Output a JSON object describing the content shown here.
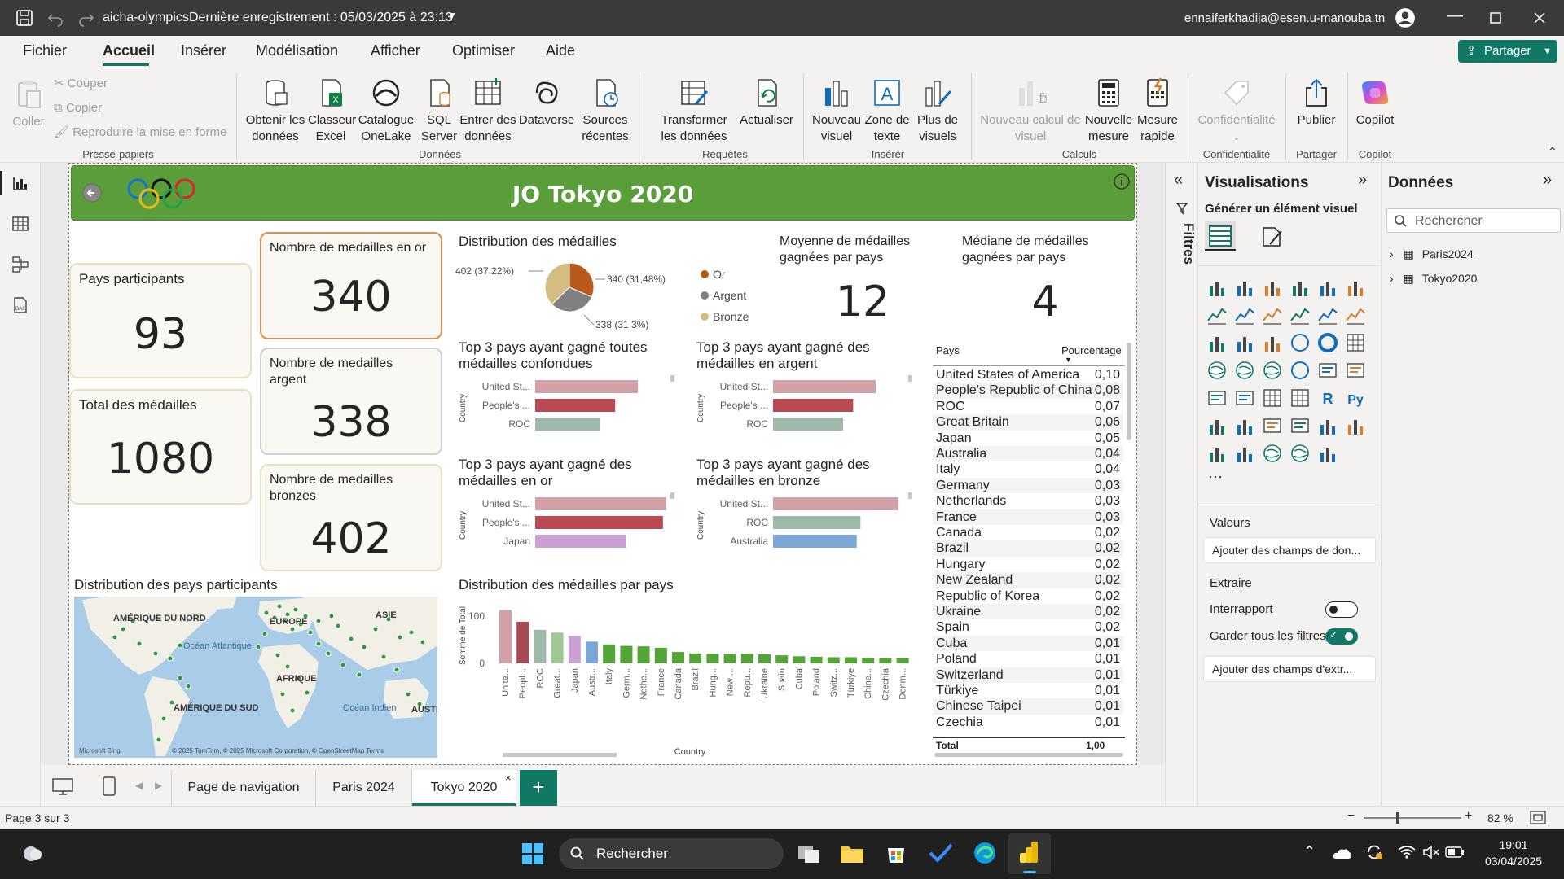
{
  "titlebar": {
    "file": "aicha-olympics",
    "saved": "Dernière enregistrement : 05/03/2025 à 23:13",
    "user": "ennaiferkhadija@esen.u-manouba.tn"
  },
  "menu": {
    "items": [
      "Fichier",
      "Accueil",
      "Insérer",
      "Modélisation",
      "Afficher",
      "Optimiser",
      "Aide"
    ],
    "share": "Partager"
  },
  "ribbon": {
    "coller": "Coller",
    "couper": "Couper",
    "copier": "Copier",
    "reproduire": "Reproduire la mise en forme",
    "presse": "Presse-papiers",
    "obtenir": "Obtenir les données",
    "classeur": "Classeur Excel",
    "onelake": "Catalogue OneLake",
    "sql": "SQL Server",
    "entrer": "Entrer des données",
    "dataverse": "Dataverse",
    "sources": "Sources récentes",
    "donnees": "Données",
    "transformer": "Transformer les données",
    "actualiser": "Actualiser",
    "requetes": "Requêtes",
    "nouveau_visuel": "Nouveau visuel",
    "zone_texte": "Zone de texte",
    "plus_visuels": "Plus de visuels",
    "inserer": "Insérer",
    "nouveau_calcul": "Nouveau calcul de visuel",
    "nouvelle_mesure": "Nouvelle mesure",
    "mesure_rapide": "Mesure rapide",
    "calculs": "Calculs",
    "confidentialite": "Confidentialité",
    "publier": "Publier",
    "partager": "Partager",
    "copilot": "Copilot"
  },
  "report": {
    "title": "JO Tokyo 2020",
    "cards": {
      "pays_label": "Pays participants",
      "pays_value": "93",
      "total_label": "Total des médailles",
      "total_value": "1080",
      "or_label": "Nombre de medailles en or",
      "or_value": "340",
      "argent_label": "Nombre de medailles argent",
      "argent_value": "338",
      "bronze_label": "Nombre de medailles bronzes",
      "bronze_value": "402",
      "moyenne_label": "Moyenne de médailles gagnées par pays",
      "moyenne_value": "12",
      "mediane_label": "Médiane de médailles gagnées par pays",
      "mediane_value": "4"
    },
    "pie": {
      "title": "Distribution des médailles",
      "labels": {
        "bronze": "402 (37,22%)",
        "or": "340 (31,48%)",
        "argent": "338 (31,3%)"
      },
      "legend": [
        "Or",
        "Argent",
        "Bronze"
      ]
    },
    "top_all": {
      "title": "Top 3 pays ayant gagné toutes médailles confondues",
      "axis": "Country",
      "cats": [
        "United St...",
        "People's ...",
        "ROC"
      ]
    },
    "top_argent": {
      "title": "Top 3 pays ayant gagné des médailles en argent",
      "axis": "Country",
      "cats": [
        "United St...",
        "People's ...",
        "ROC"
      ]
    },
    "top_or": {
      "title": "Top 3 pays ayant gagné des médailles en or",
      "axis": "Country",
      "cats": [
        "United St...",
        "People's ...",
        "Japan"
      ]
    },
    "top_bronze": {
      "title": "Top 3 pays ayant gagné des médailles en bronze",
      "axis": "Country",
      "cats": [
        "United St...",
        "ROC",
        "Australia"
      ]
    },
    "map": {
      "title": "Distribution des pays participants",
      "labels": [
        "AMÉRIQUE DU NORD",
        "EUROPE",
        "ASIE",
        "Océan Atlantique",
        "AFRIQUE",
        "AMÉRIQUE DU SUD",
        "Océan Indien",
        "AUSTR"
      ],
      "credit": "© 2025 TomTom, © 2025 Microsoft Corporation, © OpenStreetMap  Terms",
      "bing": "Microsoft Bing"
    },
    "bar": {
      "title": "Distribution des médailles par pays",
      "ylabel": "Somme de Total",
      "xlabel": "Country",
      "yticks": [
        "100",
        "0"
      ]
    },
    "table": {
      "col1": "Pays",
      "col2": "Pourcentage",
      "total_label": "Total",
      "total_value": "1,00",
      "rows": [
        [
          "United States of America",
          "0,10"
        ],
        [
          "People's Republic of China",
          "0,08"
        ],
        [
          "ROC",
          "0,07"
        ],
        [
          "Great Britain",
          "0,06"
        ],
        [
          "Japan",
          "0,05"
        ],
        [
          "Australia",
          "0,04"
        ],
        [
          "Italy",
          "0,04"
        ],
        [
          "Germany",
          "0,03"
        ],
        [
          "Netherlands",
          "0,03"
        ],
        [
          "France",
          "0,03"
        ],
        [
          "Canada",
          "0,02"
        ],
        [
          "Brazil",
          "0,02"
        ],
        [
          "Hungary",
          "0,02"
        ],
        [
          "New Zealand",
          "0,02"
        ],
        [
          "Republic of Korea",
          "0,02"
        ],
        [
          "Ukraine",
          "0,02"
        ],
        [
          "Spain",
          "0,02"
        ],
        [
          "Cuba",
          "0,01"
        ],
        [
          "Poland",
          "0,01"
        ],
        [
          "Switzerland",
          "0,01"
        ],
        [
          "Türkiye",
          "0,01"
        ],
        [
          "Chinese Taipei",
          "0,01"
        ],
        [
          "Czechia",
          "0,01"
        ]
      ]
    }
  },
  "chart_data": [
    {
      "type": "pie",
      "title": "Distribution des médailles",
      "categories": [
        "Or",
        "Argent",
        "Bronze"
      ],
      "values": [
        340,
        338,
        402
      ],
      "colors": [
        "#b85a1b",
        "#808080",
        "#d4bd80"
      ]
    },
    {
      "type": "bar",
      "title": "Top 3 pays ayant gagné toutes médailles confondues",
      "categories": [
        "United St...",
        "People's ...",
        "ROC"
      ],
      "values": [
        113,
        88,
        71
      ],
      "colors": [
        "#d4a0a8",
        "#b84a54",
        "#9fb9a8"
      ]
    },
    {
      "type": "bar",
      "title": "Top 3 pays ayant gagné des médailles en argent",
      "categories": [
        "United St...",
        "People's ...",
        "ROC"
      ],
      "values": [
        41,
        32,
        28
      ],
      "colors": [
        "#d4a0a8",
        "#b84a54",
        "#9fb9a8"
      ]
    },
    {
      "type": "bar",
      "title": "Top 3 pays ayant gagné des médailles en or",
      "categories": [
        "United St...",
        "People's ...",
        "Japan"
      ],
      "values": [
        39,
        38,
        27
      ],
      "colors": [
        "#d4a0a8",
        "#b84a54",
        "#c9a0d4"
      ]
    },
    {
      "type": "bar",
      "title": "Top 3 pays ayant gagné des médailles en bronze",
      "categories": [
        "United St...",
        "ROC",
        "Australia"
      ],
      "values": [
        33,
        23,
        22
      ],
      "colors": [
        "#d4a0a8",
        "#9fb9a8",
        "#7aa7d6"
      ]
    },
    {
      "type": "bar",
      "title": "Distribution des médailles par pays",
      "xlabel": "Country",
      "ylabel": "Somme de Total",
      "yticks": [
        0,
        100
      ],
      "categories": [
        "Unite...",
        "Peopl...",
        "ROC",
        "Great...",
        "Japan",
        "Austr...",
        "Italy",
        "Germ...",
        "Nethe...",
        "France",
        "Canada",
        "Brazil",
        "Hung...",
        "New ...",
        "Repu...",
        "Ukraine",
        "Spain",
        "Cuba",
        "Poland",
        "Switz...",
        "Türkiye",
        "Chine...",
        "Czechia",
        "Denm..."
      ],
      "values": [
        113,
        88,
        71,
        65,
        58,
        46,
        40,
        37,
        36,
        33,
        24,
        21,
        20,
        20,
        20,
        19,
        17,
        15,
        14,
        13,
        13,
        12,
        11,
        11
      ]
    }
  ],
  "vispane": {
    "title": "Visualisations",
    "gen": "Générer un élément visuel",
    "valeurs": "Valeurs",
    "add_fields": "Ajouter des champs de don...",
    "extraire": "Extraire",
    "interrapport": "Interrapport",
    "garder": "Garder tous les filtres",
    "add_extract": "Ajouter des champs d'extr..."
  },
  "filters": {
    "label": "Filtres"
  },
  "datapane": {
    "title": "Données",
    "search": "Rechercher",
    "tables": [
      "Paris2024",
      "Tokyo2020"
    ]
  },
  "tabs": [
    "Page de navigation",
    "Paris 2024",
    "Tokyo 2020"
  ],
  "status": {
    "page": "Page 3 sur 3",
    "zoom": "82 %"
  },
  "taskbar": {
    "search": "Rechercher",
    "time": "19:01",
    "date": "03/04/2025"
  },
  "colors": {
    "accent": "#117865",
    "header_green": "#5a9e3a",
    "bar_green": "#53a537"
  }
}
